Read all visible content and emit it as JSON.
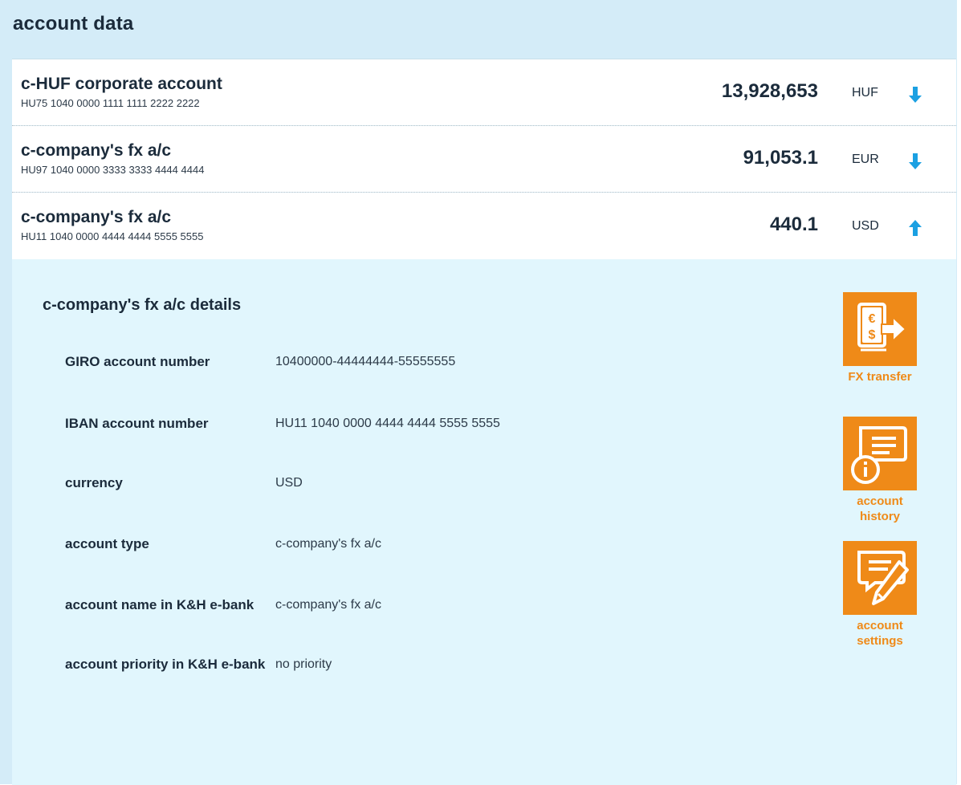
{
  "header": {
    "title": "account data"
  },
  "accounts": [
    {
      "name": "c-HUF corporate account",
      "iban": "HU75 1040 0000 1111 1111 2222 2222",
      "amount": "13,928,653",
      "currency": "HUF",
      "expanded": false
    },
    {
      "name": "c-company's fx a/c",
      "iban": "HU97 1040 0000 3333 3333 4444 4444",
      "amount": "91,053.1",
      "currency": "EUR",
      "expanded": false
    },
    {
      "name": "c-company's fx a/c",
      "iban": "HU11 1040 0000 4444 4444 5555 5555",
      "amount": "440.1",
      "currency": "USD",
      "expanded": true
    }
  ],
  "details": {
    "title": "c-company's fx a/c details",
    "rows": [
      {
        "label": "GIRO account number",
        "value": "10400000-44444444-55555555"
      },
      {
        "label": "IBAN account number",
        "value": "HU11 1040 0000 4444 4444 5555 5555"
      },
      {
        "label": "currency",
        "value": "USD"
      },
      {
        "label": "account type",
        "value": "c-company's fx a/c"
      },
      {
        "label": "account name in K&H e-bank",
        "value": "c-company's fx a/c"
      },
      {
        "label": "account priority in K&H e-bank",
        "value": "no priority"
      }
    ]
  },
  "actions": [
    {
      "label": "FX transfer",
      "icon": "fx-transfer-icon"
    },
    {
      "label": "account history",
      "icon": "account-history-icon"
    },
    {
      "label": "account settings",
      "icon": "account-settings-icon"
    }
  ],
  "colors": {
    "panel_bg": "#d4ecf8",
    "details_bg": "#e1f6fd",
    "accent_orange": "#ef8a18",
    "arrow_blue": "#1ba0e2",
    "text_dark": "#1b2b3b"
  }
}
